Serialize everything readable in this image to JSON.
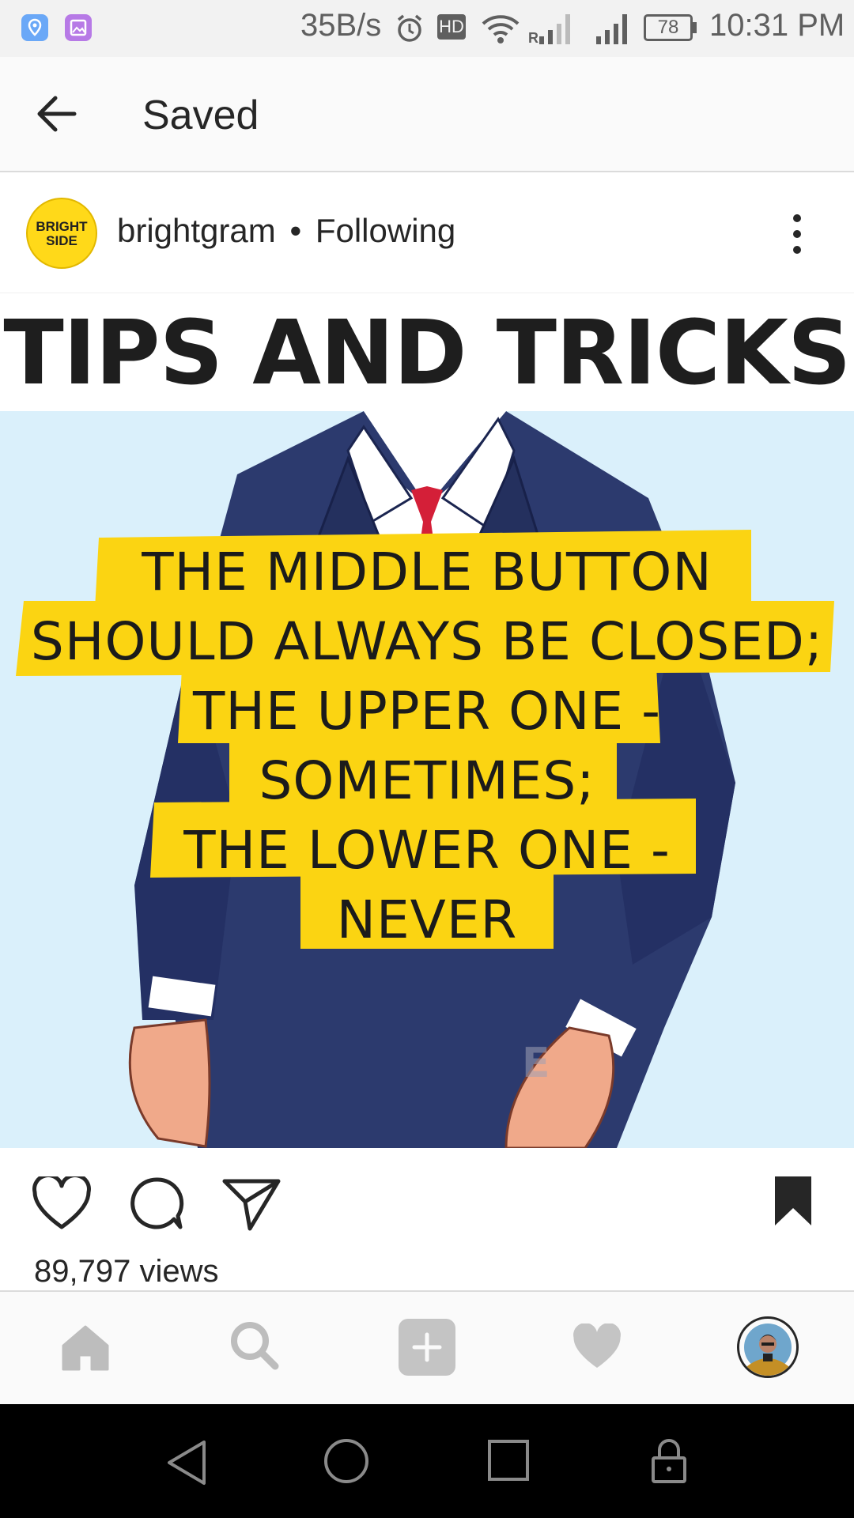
{
  "status_bar": {
    "speed": "35B/s",
    "hd_label": "HD",
    "roaming_label": "R",
    "battery": "78",
    "time": "10:31 PM"
  },
  "header": {
    "title": "Saved",
    "back_icon": "arrow-left-icon"
  },
  "post": {
    "avatar_text_line1": "BRIGHT",
    "avatar_text_line2": "SIDE",
    "username": "brightgram",
    "separator": "•",
    "follow_status": "Following",
    "more_icon": "more-vertical-icon",
    "image": {
      "heading": "TIPS AND TRICKS",
      "caption_lines": [
        "THE MIDDLE BUTTON",
        "SHOULD ALWAYS BE CLOSED;",
        "THE UPPER ONE -",
        "SOMETIMES;",
        "THE LOWER ONE -",
        "NEVER"
      ],
      "watermark": "E",
      "highlight_color": "#fbd412",
      "background_color": "#daf0fb",
      "suit_color": "#2c3a6e"
    },
    "actions": {
      "like_icon": "heart-icon",
      "comment_icon": "comment-icon",
      "share_icon": "send-icon",
      "save_icon": "bookmark-icon"
    },
    "views": "89,797 views"
  },
  "bottom_nav": [
    "home-icon",
    "search-icon",
    "add-icon",
    "activity-heart-icon",
    "profile-avatar"
  ],
  "system_nav": [
    "back-icon",
    "home-circle-icon",
    "recents-icon",
    "lock-icon"
  ]
}
